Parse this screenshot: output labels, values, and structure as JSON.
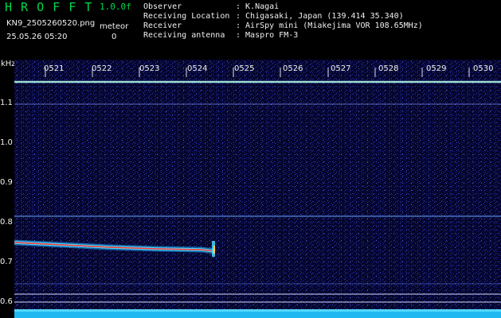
{
  "header": {
    "title": "H R O F F T",
    "version": "1.0.0f",
    "filename": "KN9_2505260520.png",
    "datetime": "25.05.26 05:20",
    "meteor_label": "meteor",
    "meteor_count": "0",
    "info": [
      {
        "label": "Observer",
        "value": ": K.Nagai"
      },
      {
        "label": "Receiving Location",
        "value": ": Chigasaki, Japan (139.414 35.340)"
      },
      {
        "label": "Receiver",
        "value": ": AirSpy mini (Miakejima VOR 108.65MHz)"
      },
      {
        "label": "Receiving antenna",
        "value": ": Maspro FM-3"
      }
    ]
  },
  "axis": {
    "y_unit": "kHz",
    "y_ticks": [
      "1.1",
      "1.0",
      "0.9",
      "0.8",
      "0.7",
      "0.6"
    ],
    "x_ticks": [
      "0521",
      "0522",
      "0523",
      "0524",
      "0525",
      "0526",
      "0527",
      "0528",
      "0529",
      "0530"
    ]
  },
  "colors": {
    "background": "#000000",
    "plot_bg": "#05052a",
    "title_green": "#00d84a",
    "trace_cyan": "#6fd0ff",
    "trace_red": "#ff3030"
  }
}
